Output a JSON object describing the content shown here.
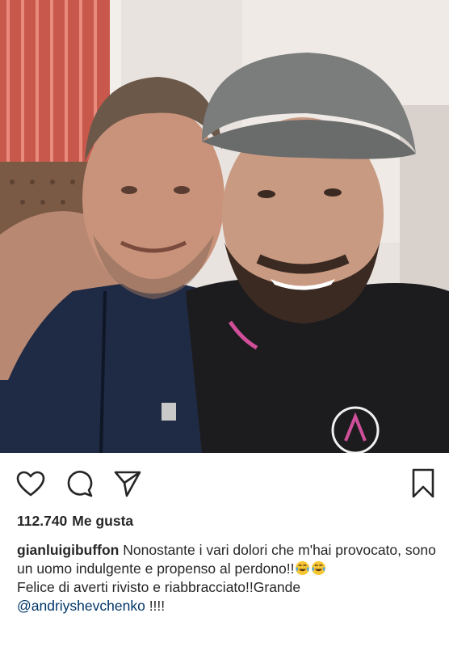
{
  "post": {
    "photo_alt": "",
    "actions": {
      "like_icon": "heart-icon",
      "comment_icon": "comment-icon",
      "share_icon": "share-icon",
      "save_icon": "bookmark-icon"
    },
    "likes": {
      "count": "112.740",
      "label": "Me gusta"
    },
    "caption": {
      "username": "gianluigibuffon",
      "text_line1": "Nonostante i vari dolori che m'hai provocato, sono un uomo indulgente e propenso al perdono!!",
      "emoji": "face-with-tears-of-joy",
      "text_line2": "Felice di averti rivisto e riabbracciato!!Grande",
      "mention": "@andriyshevchenko",
      "text_end": " !!!!"
    }
  },
  "colors": {
    "text": "#262626",
    "mention": "#003569",
    "background": "#ffffff"
  }
}
